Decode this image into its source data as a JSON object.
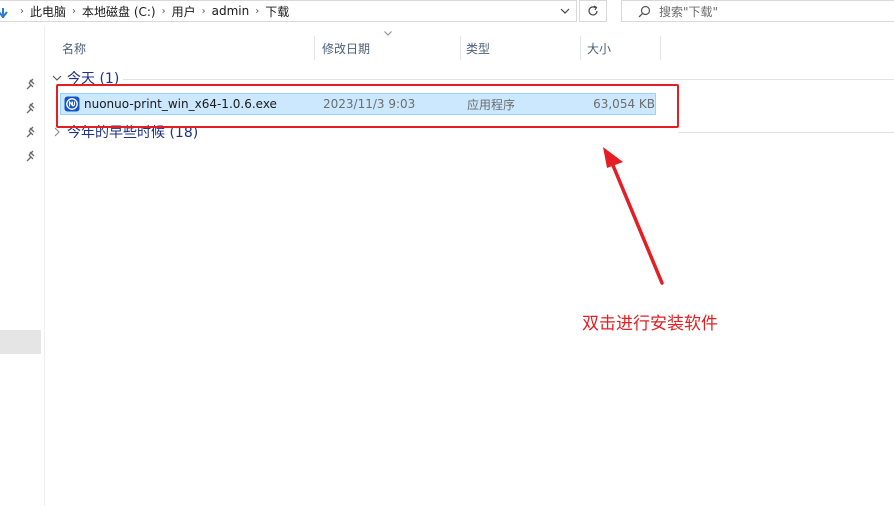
{
  "address_bar": {
    "breadcrumbs": [
      "此电脑",
      "本地磁盘 (C:)",
      "用户",
      "admin",
      "下载"
    ]
  },
  "search": {
    "placeholder": "搜索\"下载\""
  },
  "columns": [
    "名称",
    "修改日期",
    "类型",
    "大小"
  ],
  "groups": [
    {
      "label": "今天 (1)",
      "expanded": true
    },
    {
      "label": "今年的早些时候 (18)",
      "expanded": false
    }
  ],
  "files": [
    {
      "name": "nuonuo-print_win_x64-1.0.6.exe",
      "modified": "2023/11/3 9:03",
      "type": "应用程序",
      "size": "63,054 KB"
    }
  ],
  "annotation": {
    "text": "双击进行安装软件",
    "color": "#e41e22"
  },
  "colors": {
    "selection_bg": "#cce8ff",
    "selection_border": "#99d1ff",
    "group_text": "#1e3287",
    "header_text": "#4c607a"
  }
}
